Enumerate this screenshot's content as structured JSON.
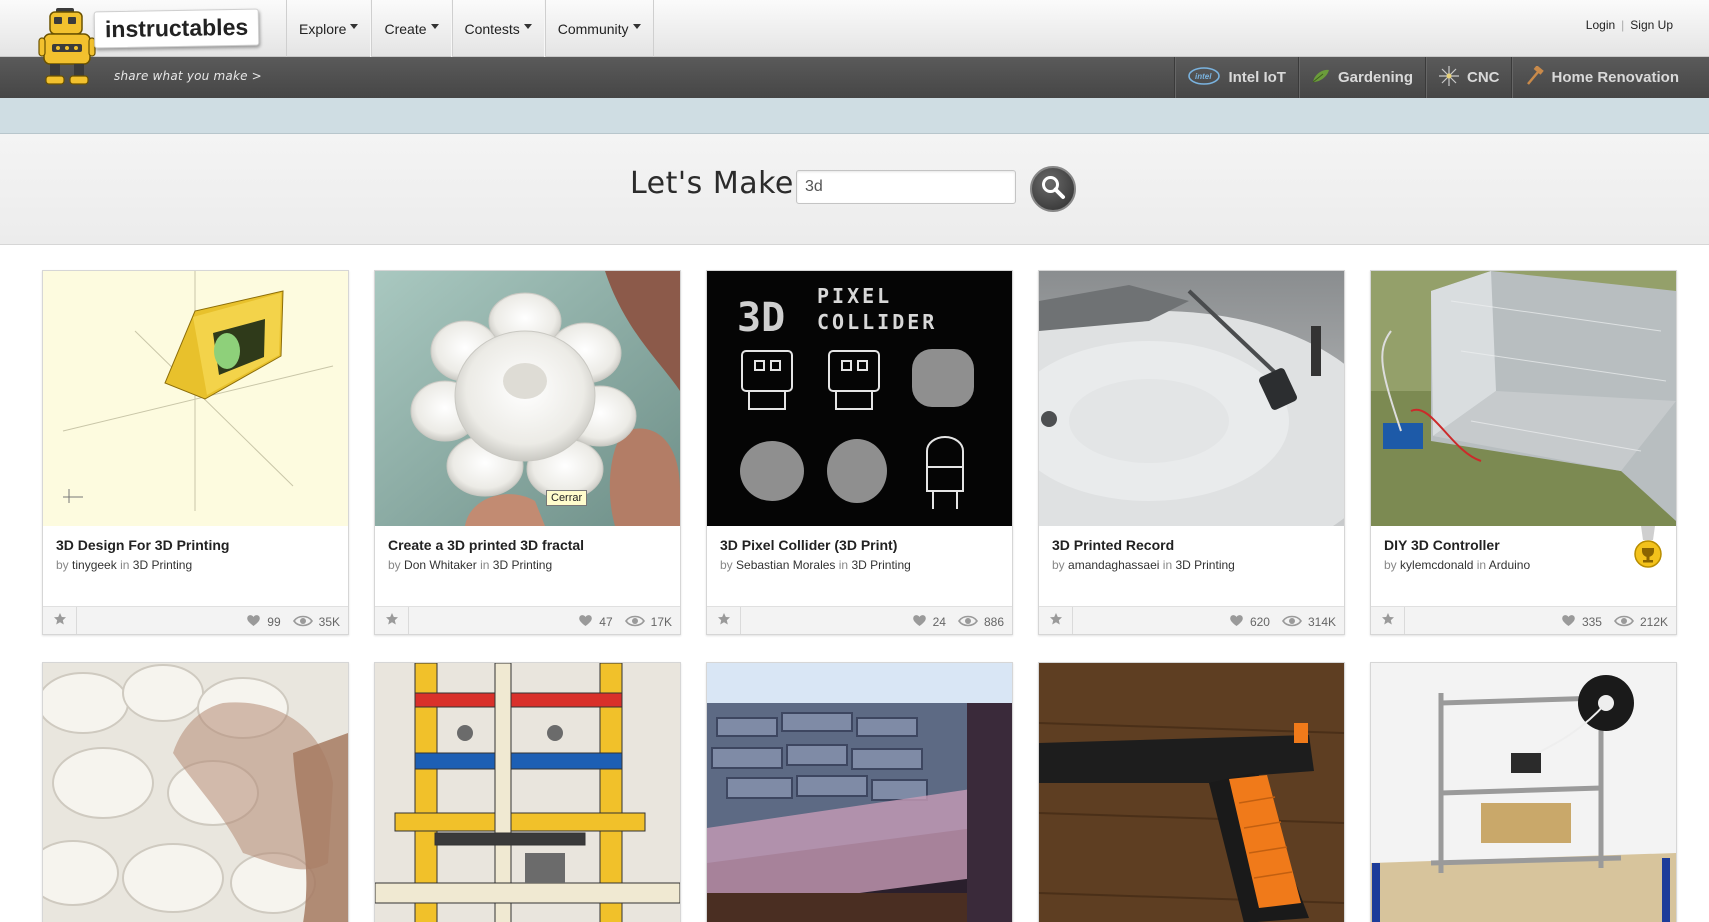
{
  "header": {
    "logo_text": "instructables",
    "tagline": "share what you make  >",
    "nav": [
      {
        "label": "Explore"
      },
      {
        "label": "Create"
      },
      {
        "label": "Contests"
      },
      {
        "label": "Community"
      }
    ],
    "login": "Login",
    "signup": "Sign Up"
  },
  "channels": [
    {
      "label": "Intel IoT",
      "icon": "intel-logo-icon"
    },
    {
      "label": "Gardening",
      "icon": "leaf-icon"
    },
    {
      "label": "CNC",
      "icon": "spark-icon"
    },
    {
      "label": "Home Renovation",
      "icon": "hammer-icon"
    }
  ],
  "search": {
    "heading": "Let's Make",
    "value": "3d"
  },
  "tooltip": "Cerrar",
  "cards": [
    {
      "title": "3D Design For 3D Printing",
      "by": "by",
      "author": "tinygeek",
      "in": "in",
      "category": "3D Printing",
      "favorites": "99",
      "views": "35K"
    },
    {
      "title": "Create a 3D printed 3D fractal",
      "by": "by",
      "author": "Don Whitaker",
      "in": "in",
      "category": "3D Printing",
      "favorites": "47",
      "views": "17K"
    },
    {
      "title": "3D Pixel Collider (3D Print)",
      "by": "by",
      "author": "Sebastian Morales",
      "in": "in",
      "category": "3D Printing",
      "favorites": "24",
      "views": "886"
    },
    {
      "title": "3D Printed Record",
      "by": "by",
      "author": "amandaghassaei",
      "in": "in",
      "category": "3D Printing",
      "favorites": "620",
      "views": "314K"
    },
    {
      "title": "DIY 3D Controller",
      "by": "by",
      "author": "kylemcdonald",
      "in": "in",
      "category": "Arduino",
      "favorites": "335",
      "views": "212K"
    }
  ],
  "pixel_collider_image_text": [
    "PIXEL",
    "COLLIDER",
    "3D"
  ]
}
